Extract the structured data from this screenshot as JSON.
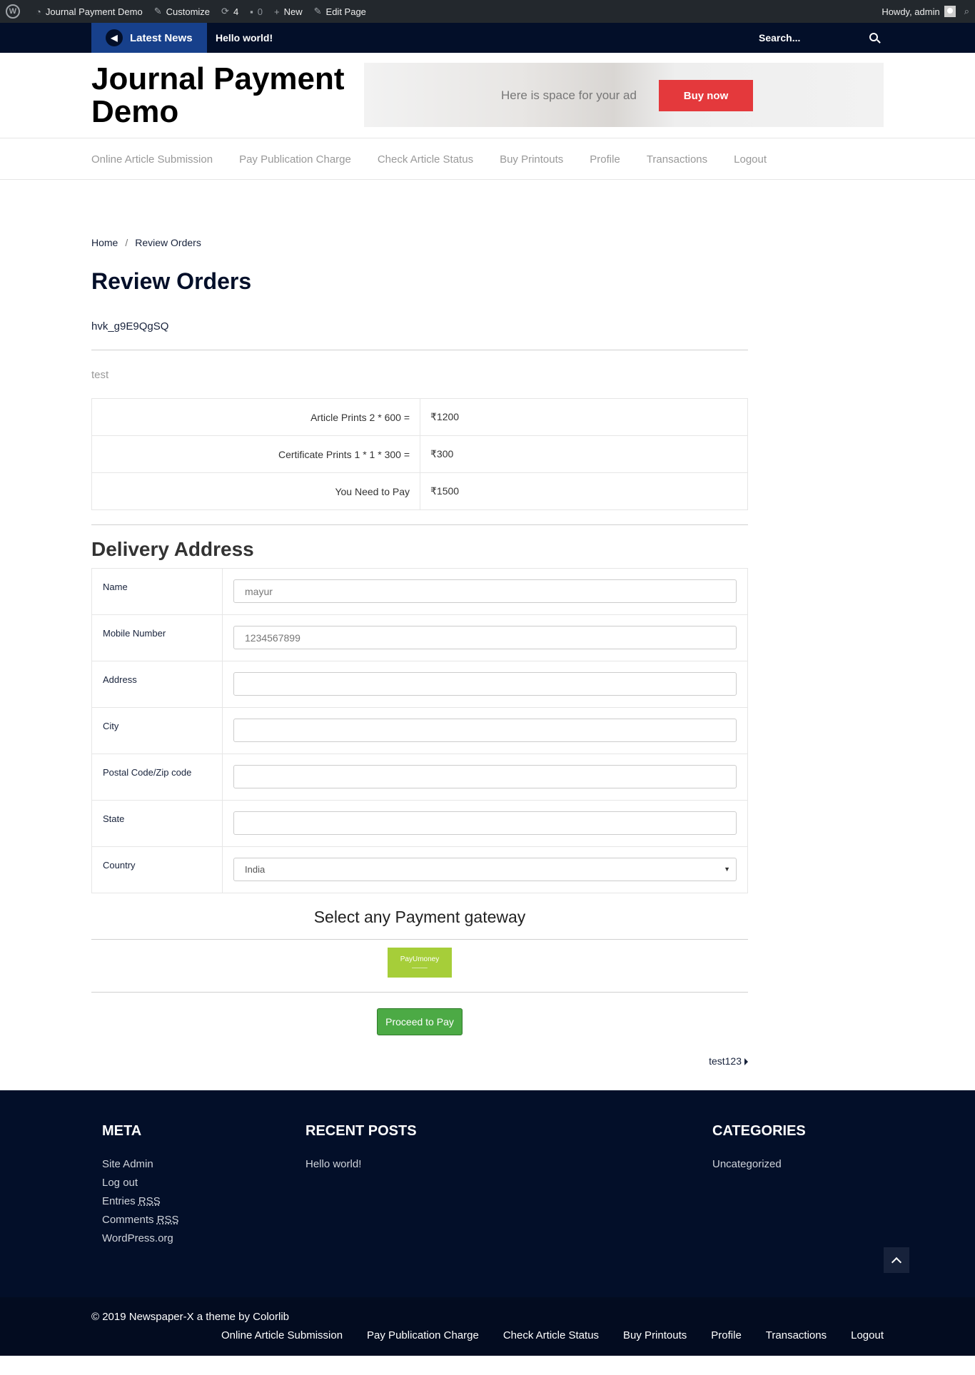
{
  "adminbar": {
    "site_name": "Journal Payment Demo",
    "customize": "Customize",
    "updates_count": "4",
    "comments_count": "0",
    "new": "New",
    "edit_page": "Edit Page",
    "howdy": "Howdy, admin"
  },
  "newsbar": {
    "latest_label": "Latest News",
    "headline": "Hello world!",
    "search_label": "Search..."
  },
  "header": {
    "site_title": "Journal Payment Demo",
    "ad_text": "Here is space for your ad",
    "ad_button": "Buy now"
  },
  "nav": {
    "items": [
      "Online Article Submission",
      "Pay Publication Charge",
      "Check Article Status",
      "Buy Printouts",
      "Profile",
      "Transactions",
      "Logout"
    ]
  },
  "breadcrumb": {
    "home": "Home",
    "sep": "/",
    "current": "Review Orders"
  },
  "page": {
    "title": "Review Orders",
    "code": "hvk_g9E9QgSQ",
    "note": "test"
  },
  "prices": [
    {
      "label": "Article Prints 2 * 600 =",
      "value": "₹1200"
    },
    {
      "label": "Certificate Prints 1 * 1 * 300 =",
      "value": "₹300"
    },
    {
      "label": "You Need to Pay",
      "value": "₹1500"
    }
  ],
  "delivery": {
    "title": "Delivery Address",
    "fields": [
      {
        "label": "Name",
        "value": "mayur"
      },
      {
        "label": "Mobile Number",
        "value": "1234567899"
      },
      {
        "label": "Address",
        "value": ""
      },
      {
        "label": "City",
        "value": ""
      },
      {
        "label": "Postal Code/Zip code",
        "value": ""
      },
      {
        "label": "State",
        "value": ""
      },
      {
        "label": "Country",
        "value": "India"
      }
    ]
  },
  "payment": {
    "title": "Select any Payment gateway",
    "gateway_name": "PayUmoney",
    "proceed_button": "Proceed to Pay"
  },
  "next_post": "test123",
  "footer": {
    "meta_title": "META",
    "meta_links": [
      "Site Admin",
      "Log out",
      "Entries",
      "Comments",
      "WordPress.org"
    ],
    "rss": "RSS",
    "recent_title": "RECENT POSTS",
    "recent_posts": [
      "Hello world!"
    ],
    "categories_title": "CATEGORIES",
    "categories": [
      "Uncategorized"
    ],
    "copyright": "© 2019 Newspaper-X a theme by Colorlib",
    "nav": [
      "Online Article Submission",
      "Pay Publication Charge",
      "Check Article Status",
      "Buy Printouts",
      "Profile",
      "Transactions",
      "Logout"
    ]
  }
}
